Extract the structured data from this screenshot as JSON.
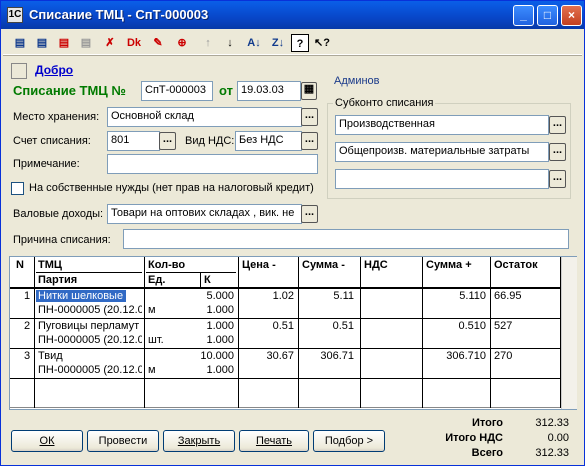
{
  "window": {
    "title": "Списание ТМЦ - СпТ-000003",
    "icon": "1C"
  },
  "toolbar": [
    "new-doc-icon",
    "copy-doc-icon",
    "delete-doc-icon",
    "gray-icon",
    "delete-mark-icon",
    "dk-icon",
    "edit-icon",
    "move-icon",
    "up-arrow-icon",
    "down-arrow-icon",
    "sort-asc-icon",
    "sort-desc-icon",
    "help-icon",
    "whatsthis-icon"
  ],
  "header": {
    "dobro": "Добро",
    "doc_label": "Списание ТМЦ №",
    "doc_number": "СпТ-000003",
    "date_label": "от",
    "date": "19.03.03",
    "admin": "Админов"
  },
  "form": {
    "storage_label": "Место хранения:",
    "storage_value": "Основной склад",
    "account_label": "Счет списания:",
    "account_value": "801",
    "vat_label": "Вид НДС:",
    "vat_value": "Без НДС",
    "note_label": "Примечание:",
    "note_value": "",
    "own_needs_label": "На собственные нужды (нет прав на налоговый кредит)",
    "gross_label": "Валовые доходы:",
    "gross_value": "Товари на оптових складах , вик. не",
    "reason_label": "Причина списания:",
    "reason_value": ""
  },
  "subconto": {
    "title": "Субконто списания",
    "s1": "Производственная",
    "s2": "Общепроизв. материальные затраты",
    "s3": ""
  },
  "table": {
    "headers": {
      "n": "N",
      "item": "ТМЦ",
      "batch": "Партия",
      "qty": "Кол-во",
      "unit": "Ед.",
      "k": "К",
      "price": "Цена -",
      "sum_minus": "Сумма -",
      "vat": "НДС",
      "sum_plus": "Сумма +",
      "rest": "Остаток"
    },
    "rows": [
      {
        "n": "1",
        "item": "Нитки шелковые",
        "batch": "ПН-0000005 (20.12.0",
        "qty": "5.000",
        "unit": "м",
        "k": "1.000",
        "price": "1.02",
        "sum_minus": "5.11",
        "vat": "",
        "sum_plus": "5.110",
        "rest": "66.95"
      },
      {
        "n": "2",
        "item": "Пуговицы перламут",
        "batch": "ПН-0000005 (20.12.0",
        "qty": "1.000",
        "unit": "шт.",
        "k": "1.000",
        "price": "0.51",
        "sum_minus": "0.51",
        "vat": "",
        "sum_plus": "0.510",
        "rest": "527"
      },
      {
        "n": "3",
        "item": "Твид",
        "batch": "ПН-0000005 (20.12.0",
        "qty": "10.000",
        "unit": "м",
        "k": "1.000",
        "price": "30.67",
        "sum_minus": "306.71",
        "vat": "",
        "sum_plus": "306.710",
        "rest": "270"
      }
    ]
  },
  "totals": {
    "total_label": "Итого",
    "total_value": "312.33",
    "vat_label": "Итого НДС",
    "vat_value": "0.00",
    "all_label": "Всего",
    "all_value": "312.33"
  },
  "buttons": {
    "ok": "ОК",
    "post": "Провести",
    "close": "Закрыть",
    "print": "Печать",
    "pick": "Подбор >"
  }
}
